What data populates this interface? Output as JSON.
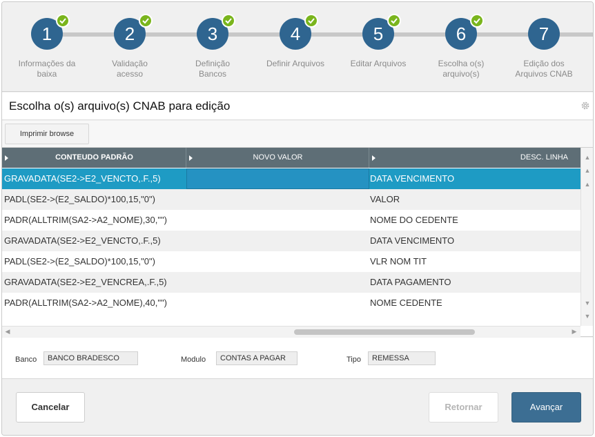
{
  "wizard": {
    "steps": [
      {
        "number": "1",
        "label_line1": "Informações da",
        "label_line2": "baixa",
        "done": true
      },
      {
        "number": "2",
        "label_line1": "Validação",
        "label_line2": "acesso",
        "done": true
      },
      {
        "number": "3",
        "label_line1": "Definição",
        "label_line2": "Bancos",
        "done": true
      },
      {
        "number": "4",
        "label_line1": "Definir Arquivos",
        "label_line2": "",
        "done": true
      },
      {
        "number": "5",
        "label_line1": "Editar Arquivos",
        "label_line2": "",
        "done": true
      },
      {
        "number": "6",
        "label_line1": "Escolha o(s)",
        "label_line2": "arquivo(s)",
        "done": true
      },
      {
        "number": "7",
        "label_line1": "Edição dos",
        "label_line2": "Arquivos CNAB",
        "done": false
      }
    ]
  },
  "page": {
    "title": "Escolha o(s) arquivo(s) CNAB para edição"
  },
  "toolbar": {
    "print_label": "Imprimir browse"
  },
  "grid": {
    "columns": [
      "CONTEUDO PADRÃO",
      "NOVO VALOR",
      "DESC. LINHA"
    ],
    "rows": [
      {
        "conteudo": "GRAVADATA(SE2->E2_VENCTO,.F.,5)",
        "novo": "",
        "desc": "DATA VENCIMENTO"
      },
      {
        "conteudo": "PADL(SE2->(E2_SALDO)*100,15,\"0\")",
        "novo": "",
        "desc": "VALOR"
      },
      {
        "conteudo": "PADR(ALLTRIM(SA2->A2_NOME),30,\"\")",
        "novo": "",
        "desc": "NOME DO CEDENTE"
      },
      {
        "conteudo": "GRAVADATA(SE2->E2_VENCTO,.F.,5)",
        "novo": "",
        "desc": "DATA VENCIMENTO"
      },
      {
        "conteudo": "PADL(SE2->(E2_SALDO)*100,15,\"0\")",
        "novo": "",
        "desc": "VLR NOM TIT"
      },
      {
        "conteudo": "GRAVADATA(SE2->E2_VENCREA,.F.,5)",
        "novo": "",
        "desc": "DATA PAGAMENTO"
      },
      {
        "conteudo": "PADR(ALLTRIM(SA2->A2_NOME),40,\"\")",
        "novo": "",
        "desc": "NOME CEDENTE"
      }
    ]
  },
  "fields": {
    "banco_label": "Banco",
    "banco_value": "BANCO BRADESCO",
    "modulo_label": "Modulo",
    "modulo_value": "CONTAS A PAGAR",
    "tipo_label": "Tipo",
    "tipo_value": "REMESSA"
  },
  "actions": {
    "cancel_label": "Cancelar",
    "back_label": "Retornar",
    "next_label": "Avançar"
  },
  "icons": {
    "check": "check-icon",
    "gear": "gear-icon"
  },
  "colors": {
    "step_circle": "#2f6590",
    "step_check": "#7ab51d",
    "grid_header": "#5e6e76",
    "row_selected": "#1e9bc4",
    "next_button": "#3c6e93"
  }
}
